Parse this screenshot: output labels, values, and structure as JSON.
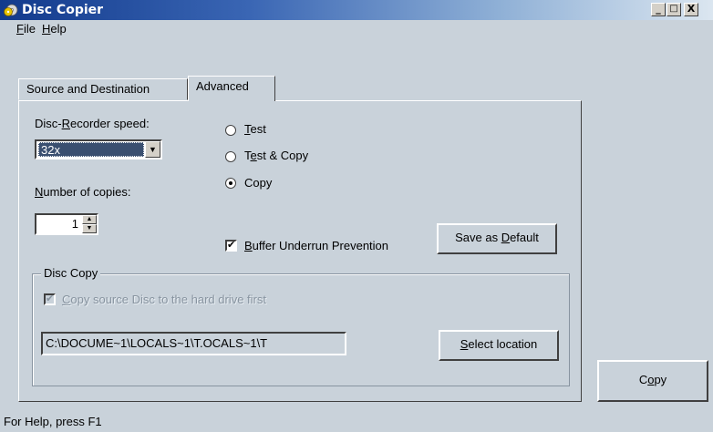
{
  "window": {
    "title": "Disc Copier",
    "minimize": "_",
    "maximize": "□",
    "close": "X"
  },
  "menu": {
    "file_key": "F",
    "file_rest": "ile",
    "help_key": "H",
    "help_rest": "elp"
  },
  "tabs": [
    {
      "label": "Source and Destination",
      "active": false
    },
    {
      "label": "Advanced",
      "active": true
    }
  ],
  "advanced": {
    "speed_label_pre": "Disc-",
    "speed_label_key": "R",
    "speed_label_post": "ecorder speed:",
    "speed_value": "32x",
    "copies_label_key": "N",
    "copies_label_post": "umber of copies:",
    "copies_value": "1",
    "radio_test_key": "T",
    "radio_test_rest": "est",
    "radio_testcopy_pre": "T",
    "radio_testcopy_key": "e",
    "radio_testcopy_rest": "st & Copy",
    "radio_copy_label": "Copy",
    "selected_mode": "Copy",
    "buffer_key": "B",
    "buffer_rest": "uffer Underrun Prevention",
    "buffer_checked": true,
    "save_default_pre": "Save as ",
    "save_default_key": "D",
    "save_default_rest": "efault"
  },
  "disc_copy": {
    "group_title": "Disc Copy",
    "copy_first_key": "C",
    "copy_first_rest": "opy source Disc to the hard drive first",
    "copy_first_checked": true,
    "path_value": "C:\\DOCUME~1\\LOCALS~1\\T.OCALS~1\\T",
    "select_location_key": "S",
    "select_location_rest": "elect location"
  },
  "copy_button": {
    "pre": "C",
    "key": "o",
    "rest": "py"
  },
  "status": {
    "text": "For Help, press F1"
  },
  "icons": {
    "app": "disc-copier-icon",
    "combo_arrow": "chevron-down-icon",
    "spin_up": "spin-up-icon",
    "spin_down": "spin-down-icon"
  }
}
